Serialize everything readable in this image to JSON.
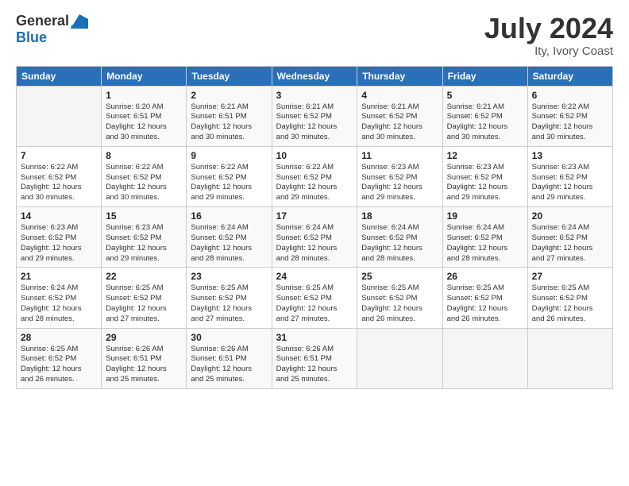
{
  "header": {
    "logo_general": "General",
    "logo_blue": "Blue",
    "month_year": "July 2024",
    "location": "Ity, Ivory Coast"
  },
  "days_of_week": [
    "Sunday",
    "Monday",
    "Tuesday",
    "Wednesday",
    "Thursday",
    "Friday",
    "Saturday"
  ],
  "weeks": [
    [
      {
        "day": "",
        "info": ""
      },
      {
        "day": "1",
        "info": "Sunrise: 6:20 AM\nSunset: 6:51 PM\nDaylight: 12 hours\nand 30 minutes."
      },
      {
        "day": "2",
        "info": "Sunrise: 6:21 AM\nSunset: 6:51 PM\nDaylight: 12 hours\nand 30 minutes."
      },
      {
        "day": "3",
        "info": "Sunrise: 6:21 AM\nSunset: 6:52 PM\nDaylight: 12 hours\nand 30 minutes."
      },
      {
        "day": "4",
        "info": "Sunrise: 6:21 AM\nSunset: 6:52 PM\nDaylight: 12 hours\nand 30 minutes."
      },
      {
        "day": "5",
        "info": "Sunrise: 6:21 AM\nSunset: 6:52 PM\nDaylight: 12 hours\nand 30 minutes."
      },
      {
        "day": "6",
        "info": "Sunrise: 6:22 AM\nSunset: 6:52 PM\nDaylight: 12 hours\nand 30 minutes."
      }
    ],
    [
      {
        "day": "7",
        "info": ""
      },
      {
        "day": "8",
        "info": "Sunrise: 6:22 AM\nSunset: 6:52 PM\nDaylight: 12 hours\nand 30 minutes."
      },
      {
        "day": "9",
        "info": "Sunrise: 6:22 AM\nSunset: 6:52 PM\nDaylight: 12 hours\nand 29 minutes."
      },
      {
        "day": "10",
        "info": "Sunrise: 6:22 AM\nSunset: 6:52 PM\nDaylight: 12 hours\nand 29 minutes."
      },
      {
        "day": "11",
        "info": "Sunrise: 6:23 AM\nSunset: 6:52 PM\nDaylight: 12 hours\nand 29 minutes."
      },
      {
        "day": "12",
        "info": "Sunrise: 6:23 AM\nSunset: 6:52 PM\nDaylight: 12 hours\nand 29 minutes."
      },
      {
        "day": "13",
        "info": "Sunrise: 6:23 AM\nSunset: 6:52 PM\nDaylight: 12 hours\nand 29 minutes."
      }
    ],
    [
      {
        "day": "14",
        "info": ""
      },
      {
        "day": "15",
        "info": "Sunrise: 6:23 AM\nSunset: 6:52 PM\nDaylight: 12 hours\nand 29 minutes."
      },
      {
        "day": "16",
        "info": "Sunrise: 6:24 AM\nSunset: 6:52 PM\nDaylight: 12 hours\nand 28 minutes."
      },
      {
        "day": "17",
        "info": "Sunrise: 6:24 AM\nSunset: 6:52 PM\nDaylight: 12 hours\nand 28 minutes."
      },
      {
        "day": "18",
        "info": "Sunrise: 6:24 AM\nSunset: 6:52 PM\nDaylight: 12 hours\nand 28 minutes."
      },
      {
        "day": "19",
        "info": "Sunrise: 6:24 AM\nSunset: 6:52 PM\nDaylight: 12 hours\nand 28 minutes."
      },
      {
        "day": "20",
        "info": "Sunrise: 6:24 AM\nSunset: 6:52 PM\nDaylight: 12 hours\nand 27 minutes."
      }
    ],
    [
      {
        "day": "21",
        "info": ""
      },
      {
        "day": "22",
        "info": "Sunrise: 6:25 AM\nSunset: 6:52 PM\nDaylight: 12 hours\nand 27 minutes."
      },
      {
        "day": "23",
        "info": "Sunrise: 6:25 AM\nSunset: 6:52 PM\nDaylight: 12 hours\nand 27 minutes."
      },
      {
        "day": "24",
        "info": "Sunrise: 6:25 AM\nSunset: 6:52 PM\nDaylight: 12 hours\nand 27 minutes."
      },
      {
        "day": "25",
        "info": "Sunrise: 6:25 AM\nSunset: 6:52 PM\nDaylight: 12 hours\nand 26 minutes."
      },
      {
        "day": "26",
        "info": "Sunrise: 6:25 AM\nSunset: 6:52 PM\nDaylight: 12 hours\nand 26 minutes."
      },
      {
        "day": "27",
        "info": "Sunrise: 6:25 AM\nSunset: 6:52 PM\nDaylight: 12 hours\nand 26 minutes."
      }
    ],
    [
      {
        "day": "28",
        "info": "Sunrise: 6:25 AM\nSunset: 6:52 PM\nDaylight: 12 hours\nand 26 minutes."
      },
      {
        "day": "29",
        "info": "Sunrise: 6:26 AM\nSunset: 6:51 PM\nDaylight: 12 hours\nand 25 minutes."
      },
      {
        "day": "30",
        "info": "Sunrise: 6:26 AM\nSunset: 6:51 PM\nDaylight: 12 hours\nand 25 minutes."
      },
      {
        "day": "31",
        "info": "Sunrise: 6:26 AM\nSunset: 6:51 PM\nDaylight: 12 hours\nand 25 minutes."
      },
      {
        "day": "",
        "info": ""
      },
      {
        "day": "",
        "info": ""
      },
      {
        "day": "",
        "info": ""
      }
    ]
  ],
  "week1_sun_info": "Sunrise: 6:22 AM\nSunset: 6:52 PM\nDaylight: 12 hours\nand 30 minutes.",
  "week2_sun_info": "Sunrise: 6:22 AM\nSunset: 6:52 PM\nDaylight: 12 hours\nand 30 minutes.",
  "week3_sun_info": "Sunrise: 6:23 AM\nSunset: 6:52 PM\nDaylight: 12 hours\nand 29 minutes.",
  "week4_sun_info": "Sunrise: 6:24 AM\nSunset: 6:52 PM\nDaylight: 12 hours\nand 28 minutes.",
  "week5_sun_info": "Sunrise: 6:25 AM\nSunset: 6:52 PM\nDaylight: 12 hours\nand 27 minutes."
}
